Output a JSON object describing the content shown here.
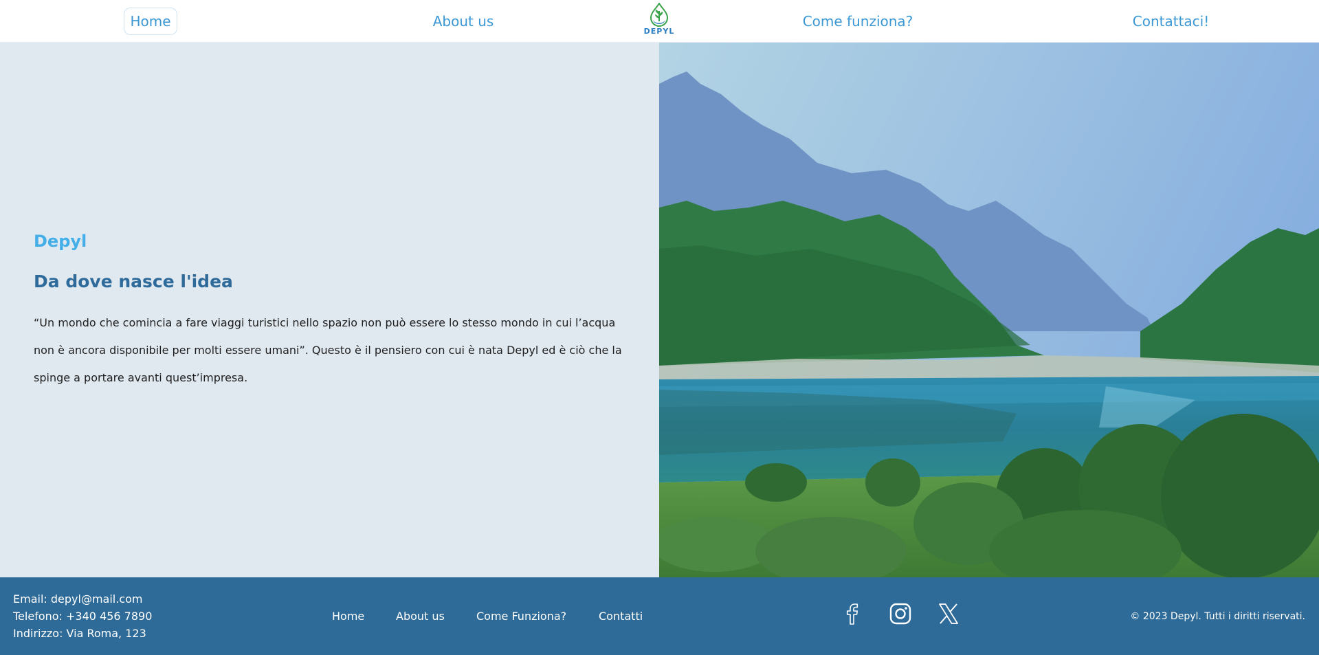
{
  "nav": {
    "home": "Home",
    "about": "About us",
    "come": "Come funziona?",
    "contatti": "Contattaci!",
    "logo_text": "DEPYL"
  },
  "hero": {
    "brand": "Depyl",
    "title": "Da dove nasce l'idea",
    "text": "“Un mondo che comincia a fare viaggi turistici nello spazio non può essere lo stesso mondo in cui l’acqua non è ancora disponibile per molti essere umani”. Questo è il pensiero con cui è nata Depyl ed è ciò che la spinge a portare avanti quest’impresa."
  },
  "footer": {
    "email": "Email: depyl@mail.com",
    "phone": "Telefono: +340 456 7890",
    "address": "Indirizzo: Via Roma, 123",
    "nav": {
      "home": "Home",
      "about": "About us",
      "come": "Come Funziona?",
      "contatti": "Contatti"
    },
    "copyright": "© 2023 Depyl. Tutti i diritti riservati."
  },
  "colors": {
    "accent": "#3a97d4",
    "brand": "#44aee8",
    "title": "#2e6a9a",
    "hero_bg": "#e0e8f0",
    "footer_bg": "#2e6b98"
  },
  "icons": [
    "logo-leaf-drop-icon",
    "facebook-icon",
    "instagram-icon",
    "x-twitter-icon"
  ]
}
